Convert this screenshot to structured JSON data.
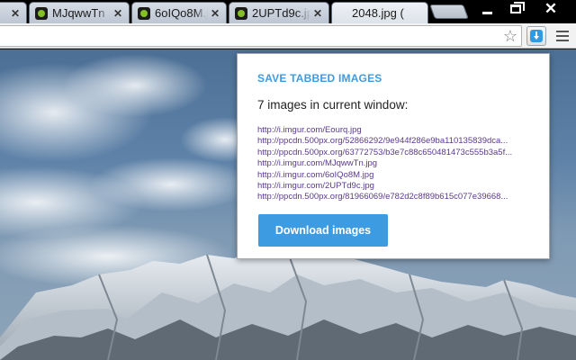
{
  "tabs": [
    {
      "title": "(",
      "icon": "page-icon",
      "close": "✕"
    },
    {
      "title": "MJqwwTn",
      "icon": "imgur-icon",
      "close": "✕"
    },
    {
      "title": "6oIQo8M.j",
      "icon": "imgur-icon",
      "close": "✕"
    },
    {
      "title": "2UPTd9c.jp",
      "icon": "imgur-icon",
      "close": "✕"
    },
    {
      "title": "2048.jpg (",
      "icon": "page-icon",
      "close": ""
    }
  ],
  "window_controls": {
    "close": "✕"
  },
  "toolbar": {
    "star": "☆"
  },
  "popup": {
    "title": "SAVE TABBED IMAGES",
    "count": "7 images in current window:",
    "urls": [
      "http://i.imgur.com/Eourq.jpg",
      "http://ppcdn.500px.org/52866292/9e944f286e9ba110135839dca...",
      "http://ppcdn.500px.org/63772753/b3e7c88c650481473c555b3a5f...",
      "http://i.imgur.com/MJqwwTn.jpg",
      "http://i.imgur.com/6oIQo8M.jpg",
      "http://i.imgur.com/2UPTd9c.jpg",
      "http://ppcdn.500px.org/81966069/e782d2c8f89b615c077e39668..."
    ],
    "button": "Download images"
  },
  "colors": {
    "accent": "#3d9be2",
    "link": "#5a3a8c"
  }
}
